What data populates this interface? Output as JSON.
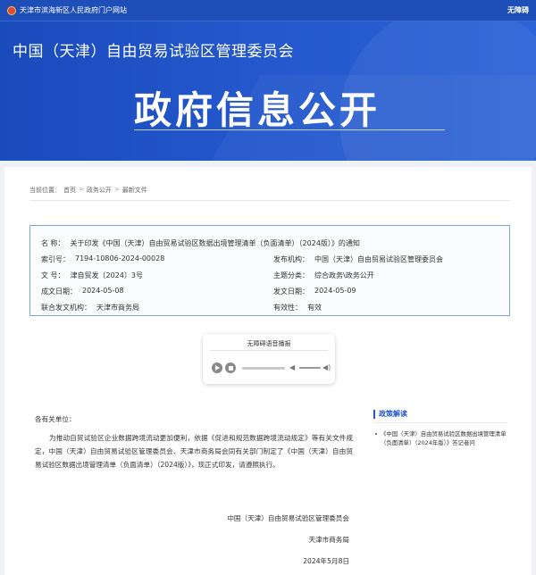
{
  "topbar": {
    "site_name": "天津市滨海新区人民政府门户网站",
    "accessibility": "无障碍"
  },
  "banner": {
    "org": "中国（天津）自由贸易试验区管理委员会",
    "title": "政府信息公开"
  },
  "breadcrumb": {
    "prefix": "当前位置：",
    "items": [
      "首页",
      "政务公开",
      "最新文件"
    ],
    "separator": ">"
  },
  "meta": {
    "name_label": "名  称：",
    "name_value": "关于印发《中国（天津）自由贸易试验区数据出境管理清单（负面清单）（2024版）》的通知",
    "index_label": "索引号：",
    "index_value": "7194-10806-2024-00028",
    "publisher_label": "发布机构：",
    "publisher_value": "中国（天津）自由贸易试验区管理委员会",
    "docno_label": "文  号：",
    "docno_value": "津自贸发〔2024〕3号",
    "topic_label": "主题分类：",
    "topic_value": "综合政务\\政务公开",
    "created_label": "成文日期：",
    "created_value": "2024-05-08",
    "published_label": "发文日期：",
    "published_value": "2024-05-09",
    "joint_label": "联合发文机构：",
    "joint_value": "天津市商务局",
    "validity_label": "有效性：",
    "validity_value": "有效"
  },
  "tts": {
    "title": "无障碍语音播报"
  },
  "body": {
    "greeting": "各有关单位：",
    "paragraph": "为推动自贸试验区企业数据跨境流动更加便利，依据《促进和规范数据跨境流动规定》等有关文件规定，中国（天津）自由贸易试验区管理委员会、天津市商务局会同有关部门制定了《中国（天津）自由贸易试验区数据出境管理清单（负面清单）（2024版）》，现正式印发，请遵照执行。",
    "sign1": "中国（天津）自由贸易试验区管理委员会",
    "sign2": "天津市商务局",
    "date": "2024年5月8日"
  },
  "sidebar": {
    "title": "政策解读",
    "item": "《中国（天津）自由贸易试验区数据出境管理清单（负面清单）（2024年版）》答记者问"
  },
  "colors": {
    "brand_blue": "#2458cc",
    "meta_border": "#7fa3d8"
  }
}
